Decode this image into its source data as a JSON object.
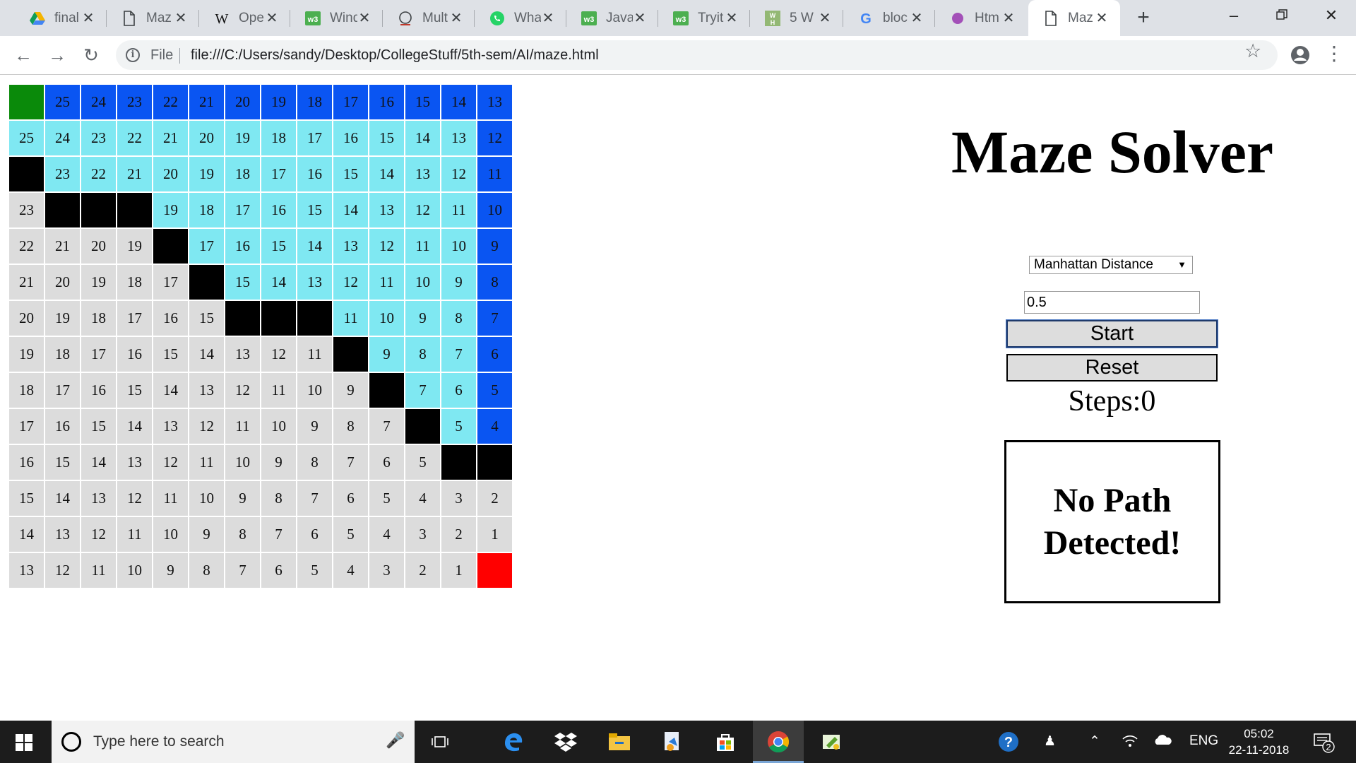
{
  "browser": {
    "tabs": [
      {
        "title": "final",
        "icon": "google-drive-icon"
      },
      {
        "title": "Maz",
        "icon": "document-icon"
      },
      {
        "title": "Ope",
        "icon": "wikipedia-icon"
      },
      {
        "title": "Wind",
        "icon": "w3schools-icon"
      },
      {
        "title": "Mult",
        "icon": "edit-doc-icon"
      },
      {
        "title": "Wha",
        "icon": "whatsapp-icon"
      },
      {
        "title": "Java",
        "icon": "w3schools-icon"
      },
      {
        "title": "Tryit",
        "icon": "w3schools-icon"
      },
      {
        "title": "5 W",
        "icon": "wikihow-icon"
      },
      {
        "title": "bloc",
        "icon": "google-icon"
      },
      {
        "title": "Htm",
        "icon": "purple-dot-icon"
      },
      {
        "title": "Maz",
        "icon": "document-icon",
        "active": true
      }
    ],
    "address": {
      "scheme_label": "File",
      "url": "file:///C:/Users/sandy/Desktop/CollegeStuff/5th-sem/AI/maze.html"
    }
  },
  "maze": {
    "legend_colors": {
      "unvisited": "#dcdcdc",
      "explored": "#7fe8f2",
      "path": "#0a55f2",
      "wall": "#000000",
      "start": "#0a8a0a",
      "goal": "#ff0000"
    },
    "rows": [
      [
        [
          "s",
          ""
        ],
        [
          "b",
          "25"
        ],
        [
          "b",
          "24"
        ],
        [
          "b",
          "23"
        ],
        [
          "b",
          "22"
        ],
        [
          "b",
          "21"
        ],
        [
          "b",
          "20"
        ],
        [
          "b",
          "19"
        ],
        [
          "b",
          "18"
        ],
        [
          "b",
          "17"
        ],
        [
          "b",
          "16"
        ],
        [
          "b",
          "15"
        ],
        [
          "b",
          "14"
        ],
        [
          "b",
          "13"
        ]
      ],
      [
        [
          "c",
          "25"
        ],
        [
          "c",
          "24"
        ],
        [
          "c",
          "23"
        ],
        [
          "c",
          "22"
        ],
        [
          "c",
          "21"
        ],
        [
          "c",
          "20"
        ],
        [
          "c",
          "19"
        ],
        [
          "c",
          "18"
        ],
        [
          "c",
          "17"
        ],
        [
          "c",
          "16"
        ],
        [
          "c",
          "15"
        ],
        [
          "c",
          "14"
        ],
        [
          "c",
          "13"
        ],
        [
          "b",
          "12"
        ]
      ],
      [
        [
          "w",
          ""
        ],
        [
          "c",
          "23"
        ],
        [
          "c",
          "22"
        ],
        [
          "c",
          "21"
        ],
        [
          "c",
          "20"
        ],
        [
          "c",
          "19"
        ],
        [
          "c",
          "18"
        ],
        [
          "c",
          "17"
        ],
        [
          "c",
          "16"
        ],
        [
          "c",
          "15"
        ],
        [
          "c",
          "14"
        ],
        [
          "c",
          "13"
        ],
        [
          "c",
          "12"
        ],
        [
          "b",
          "11"
        ]
      ],
      [
        [
          "g",
          "23"
        ],
        [
          "w",
          ""
        ],
        [
          "w",
          ""
        ],
        [
          "w",
          ""
        ],
        [
          "c",
          "19"
        ],
        [
          "c",
          "18"
        ],
        [
          "c",
          "17"
        ],
        [
          "c",
          "16"
        ],
        [
          "c",
          "15"
        ],
        [
          "c",
          "14"
        ],
        [
          "c",
          "13"
        ],
        [
          "c",
          "12"
        ],
        [
          "c",
          "11"
        ],
        [
          "b",
          "10"
        ]
      ],
      [
        [
          "g",
          "22"
        ],
        [
          "g",
          "21"
        ],
        [
          "g",
          "20"
        ],
        [
          "g",
          "19"
        ],
        [
          "w",
          ""
        ],
        [
          "c",
          "17"
        ],
        [
          "c",
          "16"
        ],
        [
          "c",
          "15"
        ],
        [
          "c",
          "14"
        ],
        [
          "c",
          "13"
        ],
        [
          "c",
          "12"
        ],
        [
          "c",
          "11"
        ],
        [
          "c",
          "10"
        ],
        [
          "b",
          "9"
        ]
      ],
      [
        [
          "g",
          "21"
        ],
        [
          "g",
          "20"
        ],
        [
          "g",
          "19"
        ],
        [
          "g",
          "18"
        ],
        [
          "g",
          "17"
        ],
        [
          "w",
          ""
        ],
        [
          "c",
          "15"
        ],
        [
          "c",
          "14"
        ],
        [
          "c",
          "13"
        ],
        [
          "c",
          "12"
        ],
        [
          "c",
          "11"
        ],
        [
          "c",
          "10"
        ],
        [
          "c",
          "9"
        ],
        [
          "b",
          "8"
        ]
      ],
      [
        [
          "g",
          "20"
        ],
        [
          "g",
          "19"
        ],
        [
          "g",
          "18"
        ],
        [
          "g",
          "17"
        ],
        [
          "g",
          "16"
        ],
        [
          "g",
          "15"
        ],
        [
          "w",
          ""
        ],
        [
          "w",
          ""
        ],
        [
          "w",
          ""
        ],
        [
          "c",
          "11"
        ],
        [
          "c",
          "10"
        ],
        [
          "c",
          "9"
        ],
        [
          "c",
          "8"
        ],
        [
          "b",
          "7"
        ]
      ],
      [
        [
          "g",
          "19"
        ],
        [
          "g",
          "18"
        ],
        [
          "g",
          "17"
        ],
        [
          "g",
          "16"
        ],
        [
          "g",
          "15"
        ],
        [
          "g",
          "14"
        ],
        [
          "g",
          "13"
        ],
        [
          "g",
          "12"
        ],
        [
          "g",
          "11"
        ],
        [
          "w",
          ""
        ],
        [
          "c",
          "9"
        ],
        [
          "c",
          "8"
        ],
        [
          "c",
          "7"
        ],
        [
          "b",
          "6"
        ]
      ],
      [
        [
          "g",
          "18"
        ],
        [
          "g",
          "17"
        ],
        [
          "g",
          "16"
        ],
        [
          "g",
          "15"
        ],
        [
          "g",
          "14"
        ],
        [
          "g",
          "13"
        ],
        [
          "g",
          "12"
        ],
        [
          "g",
          "11"
        ],
        [
          "g",
          "10"
        ],
        [
          "g",
          "9"
        ],
        [
          "w",
          ""
        ],
        [
          "c",
          "7"
        ],
        [
          "c",
          "6"
        ],
        [
          "b",
          "5"
        ]
      ],
      [
        [
          "g",
          "17"
        ],
        [
          "g",
          "16"
        ],
        [
          "g",
          "15"
        ],
        [
          "g",
          "14"
        ],
        [
          "g",
          "13"
        ],
        [
          "g",
          "12"
        ],
        [
          "g",
          "11"
        ],
        [
          "g",
          "10"
        ],
        [
          "g",
          "9"
        ],
        [
          "g",
          "8"
        ],
        [
          "g",
          "7"
        ],
        [
          "w",
          ""
        ],
        [
          "c",
          "5"
        ],
        [
          "b",
          "4"
        ]
      ],
      [
        [
          "g",
          "16"
        ],
        [
          "g",
          "15"
        ],
        [
          "g",
          "14"
        ],
        [
          "g",
          "13"
        ],
        [
          "g",
          "12"
        ],
        [
          "g",
          "11"
        ],
        [
          "g",
          "10"
        ],
        [
          "g",
          "9"
        ],
        [
          "g",
          "8"
        ],
        [
          "g",
          "7"
        ],
        [
          "g",
          "6"
        ],
        [
          "g",
          "5"
        ],
        [
          "w",
          ""
        ],
        [
          "w",
          ""
        ]
      ],
      [
        [
          "g",
          "15"
        ],
        [
          "g",
          "14"
        ],
        [
          "g",
          "13"
        ],
        [
          "g",
          "12"
        ],
        [
          "g",
          "11"
        ],
        [
          "g",
          "10"
        ],
        [
          "g",
          "9"
        ],
        [
          "g",
          "8"
        ],
        [
          "g",
          "7"
        ],
        [
          "g",
          "6"
        ],
        [
          "g",
          "5"
        ],
        [
          "g",
          "4"
        ],
        [
          "g",
          "3"
        ],
        [
          "g",
          "2"
        ]
      ],
      [
        [
          "g",
          "14"
        ],
        [
          "g",
          "13"
        ],
        [
          "g",
          "12"
        ],
        [
          "g",
          "11"
        ],
        [
          "g",
          "10"
        ],
        [
          "g",
          "9"
        ],
        [
          "g",
          "8"
        ],
        [
          "g",
          "7"
        ],
        [
          "g",
          "6"
        ],
        [
          "g",
          "5"
        ],
        [
          "g",
          "4"
        ],
        [
          "g",
          "3"
        ],
        [
          "g",
          "2"
        ],
        [
          "g",
          "1"
        ]
      ],
      [
        [
          "g",
          "13"
        ],
        [
          "g",
          "12"
        ],
        [
          "g",
          "11"
        ],
        [
          "g",
          "10"
        ],
        [
          "g",
          "9"
        ],
        [
          "g",
          "8"
        ],
        [
          "g",
          "7"
        ],
        [
          "g",
          "6"
        ],
        [
          "g",
          "5"
        ],
        [
          "g",
          "4"
        ],
        [
          "g",
          "3"
        ],
        [
          "g",
          "2"
        ],
        [
          "g",
          "1"
        ],
        [
          "e",
          ""
        ]
      ]
    ]
  },
  "panel": {
    "title": "Maze Solver",
    "heuristic_selected": "Manhattan Distance",
    "weight_value": "0.5",
    "start_label": "Start",
    "reset_label": "Reset",
    "steps_text": "Steps:0",
    "message": "No Path Detected!"
  },
  "taskbar": {
    "search_placeholder": "Type here to search",
    "language": "ENG",
    "time": "05:02",
    "date": "22-11-2018",
    "notification_count": "2"
  }
}
